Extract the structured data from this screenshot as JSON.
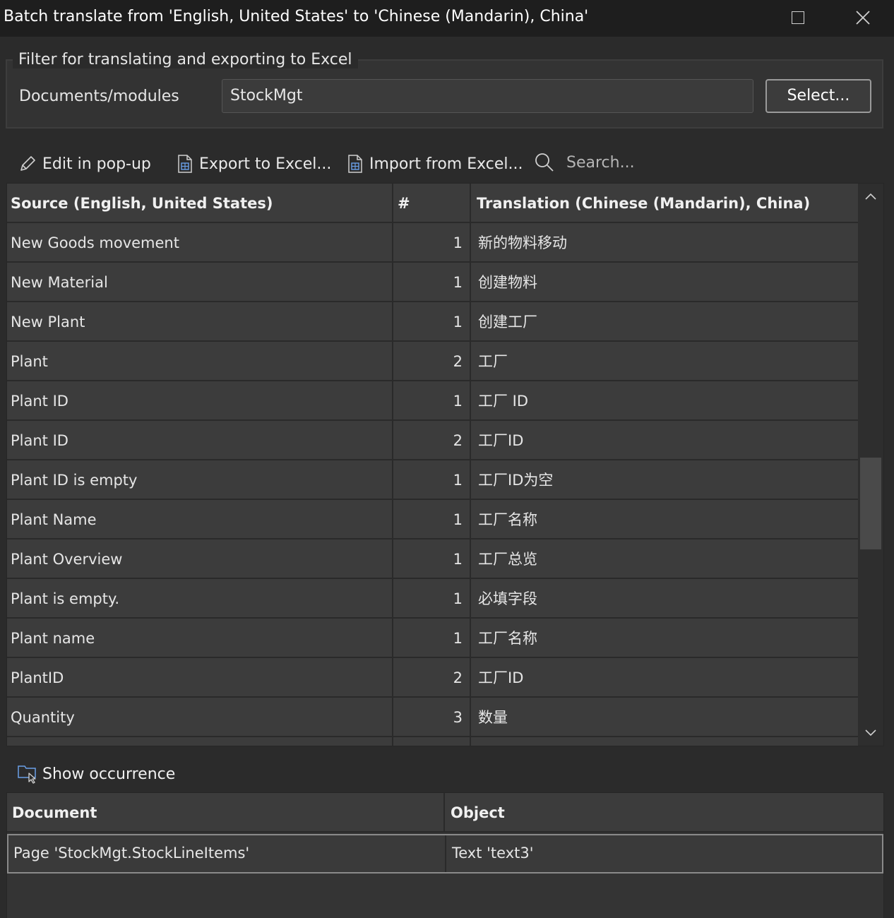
{
  "window": {
    "title": "Batch translate from 'English, United States' to 'Chinese (Mandarin), China'"
  },
  "filter": {
    "legend": "Filter for translating and exporting to Excel",
    "documents_label": "Documents/modules",
    "documents_value": "StockMgt",
    "select_label": "Select..."
  },
  "toolbar": {
    "edit_label": "Edit in pop-up",
    "export_label": "Export to Excel...",
    "import_label": "Import from Excel...",
    "search_placeholder": "Search..."
  },
  "grid": {
    "columns": [
      "Source (English, United States)",
      "#",
      "Translation (Chinese (Mandarin), China)"
    ],
    "rows": [
      {
        "source": "New Goods movement",
        "count": "1",
        "translation": "新的物料移动"
      },
      {
        "source": "New Material",
        "count": "1",
        "translation": "创建物料"
      },
      {
        "source": "New Plant",
        "count": "1",
        "translation": "创建工厂"
      },
      {
        "source": "Plant",
        "count": "2",
        "translation": "工厂"
      },
      {
        "source": "Plant ID",
        "count": "1",
        "translation": "工厂 ID"
      },
      {
        "source": "Plant ID",
        "count": "2",
        "translation": "工厂ID"
      },
      {
        "source": "Plant ID is empty",
        "count": "1",
        "translation": "工厂ID为空"
      },
      {
        "source": "Plant Name",
        "count": "1",
        "translation": "工厂名称"
      },
      {
        "source": "Plant Overview",
        "count": "1",
        "translation": "工厂总览"
      },
      {
        "source": "Plant is empty.",
        "count": "1",
        "translation": "必填字段"
      },
      {
        "source": "Plant name",
        "count": "1",
        "translation": "工厂名称"
      },
      {
        "source": "PlantID",
        "count": "2",
        "translation": "工厂ID"
      },
      {
        "source": "Quantity",
        "count": "3",
        "translation": "数量"
      }
    ]
  },
  "occurrence": {
    "button_label": "Show occurrence",
    "columns": [
      "Document",
      "Object"
    ],
    "rows": [
      {
        "document": "Page 'StockMgt.StockLineItems'",
        "object": "Text 'text3'"
      }
    ]
  }
}
